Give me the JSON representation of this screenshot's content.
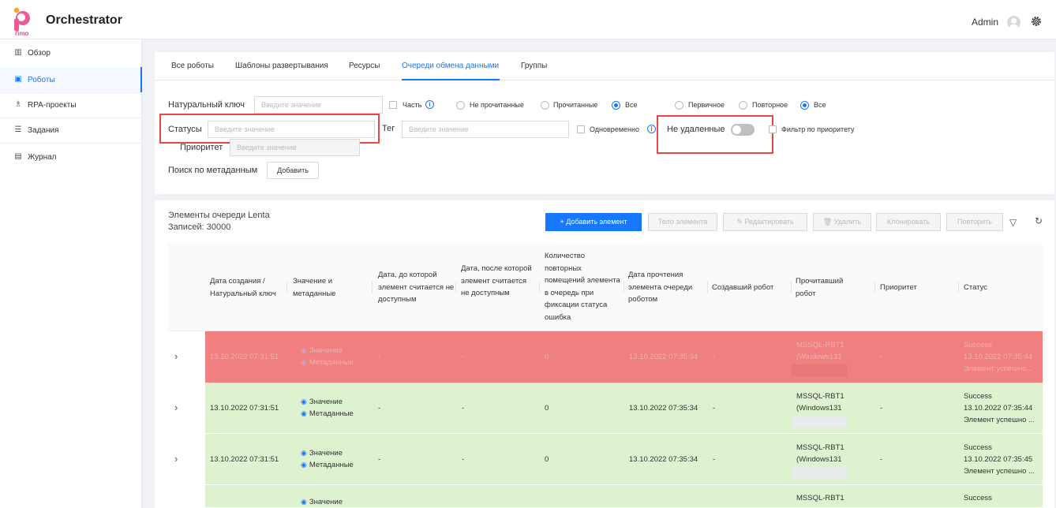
{
  "app": {
    "title": "Orchestrator",
    "user": "Admin"
  },
  "sidebar": {
    "items": [
      {
        "label": "Обзор",
        "icon": "chart-icon"
      },
      {
        "label": "Роботы",
        "icon": "robot-icon",
        "active": true
      },
      {
        "label": "RPA-проекты",
        "icon": "projects-icon"
      },
      {
        "label": "Задания",
        "icon": "tasks-icon"
      },
      {
        "label": "Журнал",
        "icon": "journal-icon"
      }
    ]
  },
  "tabs": [
    "Все роботы",
    "Шаблоны развертывания",
    "Ресурсы",
    "Очереди обмена данными",
    "Группы"
  ],
  "active_tab": "Очереди обмена данными",
  "filters": {
    "natural_key_label": "Натуральный ключ",
    "natural_key_placeholder": "Введите значение",
    "part_label": "Часть",
    "read_options": [
      "Не прочитанные",
      "Прочитанные",
      "Все"
    ],
    "read_selected": "Все",
    "primary_options": [
      "Первичное",
      "Повторное",
      "Все"
    ],
    "primary_selected": "Все",
    "statuses_label": "Статусы",
    "statuses_placeholder": "Введите значение",
    "tag_label": "Тег",
    "tag_placeholder": "Введите значение",
    "simultaneous_label": "Одновременно",
    "not_deleted_label": "Не удаленные",
    "not_deleted_on": false,
    "priority_filter_label": "Фильтр по приоритету",
    "priority_label": "Приоритет",
    "priority_placeholder": "Введите значение",
    "metadata_search_label": "Поиск по метаданным",
    "add_label": "Добавить"
  },
  "queue": {
    "title": "Элементы очереди Lenta",
    "count": "Записей: 30000",
    "buttons": {
      "add": "Добавить элемент",
      "element_type": "Тело элемента",
      "edit": "Редактировать",
      "delete": "Удалить",
      "clone": "Клонировать",
      "retry": "Повторить"
    }
  },
  "table": {
    "columns": [
      "Дата создания / Натуральный ключ",
      "Значение и метаданные",
      "Дата, до которой элемент считается не доступным",
      "Дата, после которой элемент считается не доступным",
      "Количество повторных помещений элемента в очередь при фиксации статуса ошибка",
      "Дата прочтения элемента очереди роботом",
      "Создавший робот",
      "Прочитавший робот",
      "Приоритет",
      "Статус"
    ],
    "rows": [
      {
        "style": "red",
        "created": "13.10.2022 07:31:51",
        "value": "Значение",
        "meta": "Метаданные",
        "before": "-",
        "after": "-",
        "retries": "0",
        "read_date": "13.10.2022 07:35:34",
        "creator": "-",
        "reader1": "MSSQL-RBT1",
        "reader2": "(Windows131",
        "priority": "-",
        "status": "Success",
        "status_date": "13.10.2022 07:35:44",
        "status_msg": "Элемент успешно..."
      },
      {
        "style": "green",
        "created": "13.10.2022 07:31:51",
        "value": "Значение",
        "meta": "Метаданные",
        "before": "-",
        "after": "-",
        "retries": "0",
        "read_date": "13.10.2022 07:35:34",
        "creator": "-",
        "reader1": "MSSQL-RBT1",
        "reader2": "(Windows131",
        "priority": "-",
        "status": "Success",
        "status_date": "13.10.2022 07:35:44",
        "status_msg": "Элемент успешно ..."
      },
      {
        "style": "green",
        "created": "13.10.2022 07:31:51",
        "value": "Значение",
        "meta": "Метаданные",
        "before": "-",
        "after": "-",
        "retries": "0",
        "read_date": "13.10.2022 07:35:34",
        "creator": "-",
        "reader1": "MSSQL-RBT1",
        "reader2": "(Windows131",
        "priority": "-",
        "status": "Success",
        "status_date": "13.10.2022 07:35:45",
        "status_msg": "Элемент успешно ..."
      },
      {
        "style": "green",
        "created": "",
        "value": "Значение",
        "meta": "",
        "before": "",
        "after": "",
        "retries": "",
        "read_date": "",
        "creator": "",
        "reader1": "MSSQL-RBT1",
        "reader2": "",
        "priority": "",
        "status": "Success",
        "status_date": "",
        "status_msg": ""
      }
    ]
  },
  "colors": {
    "accent": "#1677ff",
    "row_error": "#f08080",
    "row_success": "#dff2cf",
    "highlight_box": "#e34848"
  }
}
